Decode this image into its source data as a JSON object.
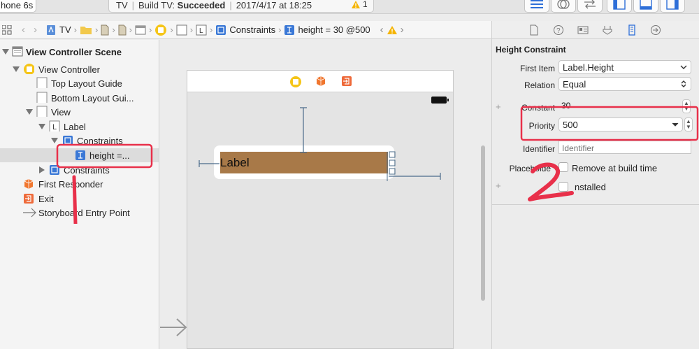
{
  "toolbar": {
    "device": "hone 6s",
    "scheme": "TV",
    "build_prefix": "Build TV: ",
    "build_status": "Succeeded",
    "timestamp": "2017/4/17 at 18:25",
    "warning_count": "1"
  },
  "jumpbar": {
    "crumbs": [
      "TV",
      "",
      "",
      "",
      "",
      "",
      "",
      "Constraints",
      "height = 30 @500"
    ]
  },
  "outline": {
    "items": [
      {
        "label": "View Controller Scene"
      },
      {
        "label": "View Controller"
      },
      {
        "label": "Top Layout Guide"
      },
      {
        "label": "Bottom Layout Gui..."
      },
      {
        "label": "View"
      },
      {
        "label": "Label"
      },
      {
        "label": "Constraints"
      },
      {
        "label": "height =..."
      },
      {
        "label": "Constraints"
      },
      {
        "label": "First Responder"
      },
      {
        "label": "Exit"
      },
      {
        "label": "Storyboard Entry Point"
      }
    ]
  },
  "canvas": {
    "label_text": "Label",
    "annotation_1": "1"
  },
  "inspector": {
    "title": "Height Constraint",
    "first_item_label": "First Item",
    "first_item_value": "Label.Height",
    "relation_label": "Relation",
    "relation_value": "Equal",
    "constant_label": "Constant",
    "constant_value": "30",
    "priority_label": "Priority",
    "priority_value": "500",
    "identifier_label": "Identifier",
    "identifier_placeholder": "Identifier",
    "placeholder_label": "Placeholde",
    "placeholder_check": "Remove at build time",
    "installed_label": "nstalled",
    "annotation_2": "2"
  },
  "colors": {
    "accent": "#2e6fd8",
    "label_fill": "#a87948",
    "annotation_red": "#e8304a",
    "warning": "#f5b400",
    "storyboard_orange": "#f29a1e"
  }
}
